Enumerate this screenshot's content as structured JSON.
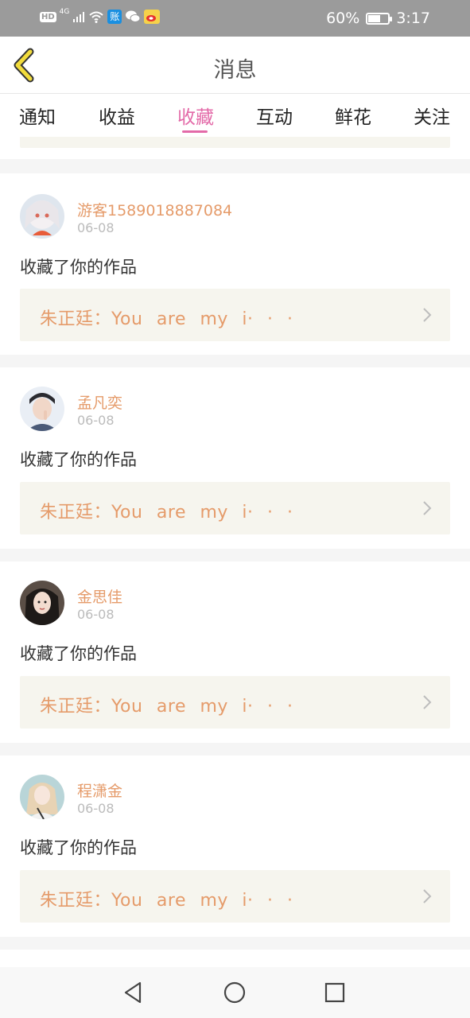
{
  "status_bar": {
    "hd": "HD",
    "network": "4G",
    "pay_icon_char": "账",
    "battery_level": "60%",
    "battery_fill": 0.6,
    "time": "3:17",
    "icons": [
      "hd-icon",
      "signal-icon",
      "wifi-icon",
      "alipay-icon",
      "wechat-icon",
      "weibo-icon",
      "battery-icon"
    ]
  },
  "header": {
    "title": "消息",
    "back_icon": "chevron-left-icon"
  },
  "tabs": [
    {
      "label": "通知"
    },
    {
      "label": "收益"
    },
    {
      "label": "收藏",
      "active": true
    },
    {
      "label": "互动"
    },
    {
      "label": "鲜花"
    },
    {
      "label": "关注"
    }
  ],
  "items": [
    {
      "user": "游客1589018887084",
      "date": "06-08",
      "action": "收藏了你的作品",
      "quote": "朱正廷：You are my i· · ·",
      "avatar": "anime-girl"
    },
    {
      "user": "孟凡奕",
      "date": "06-08",
      "action": "收藏了你的作品",
      "quote": "朱正廷：You are my i· · ·",
      "avatar": "young-man"
    },
    {
      "user": "金思佳",
      "date": "06-08",
      "action": "收藏了你的作品",
      "quote": "朱正廷：You are my i· · ·",
      "avatar": "dark-hair-woman"
    },
    {
      "user": "程潇金",
      "date": "06-08",
      "action": "收藏了你的作品",
      "quote": "朱正廷：You are my i· · ·",
      "avatar": "blonde-woman"
    }
  ],
  "colors": {
    "accent": "#e36aa8",
    "username": "#e59b6a",
    "quote_bg": "#f6f5ee",
    "status_bar": "#9b9b9b",
    "back_icon": "#f2dc3c"
  },
  "nav_bar": {
    "icons": [
      "back-triangle-icon",
      "home-circle-icon",
      "recents-square-icon"
    ]
  }
}
